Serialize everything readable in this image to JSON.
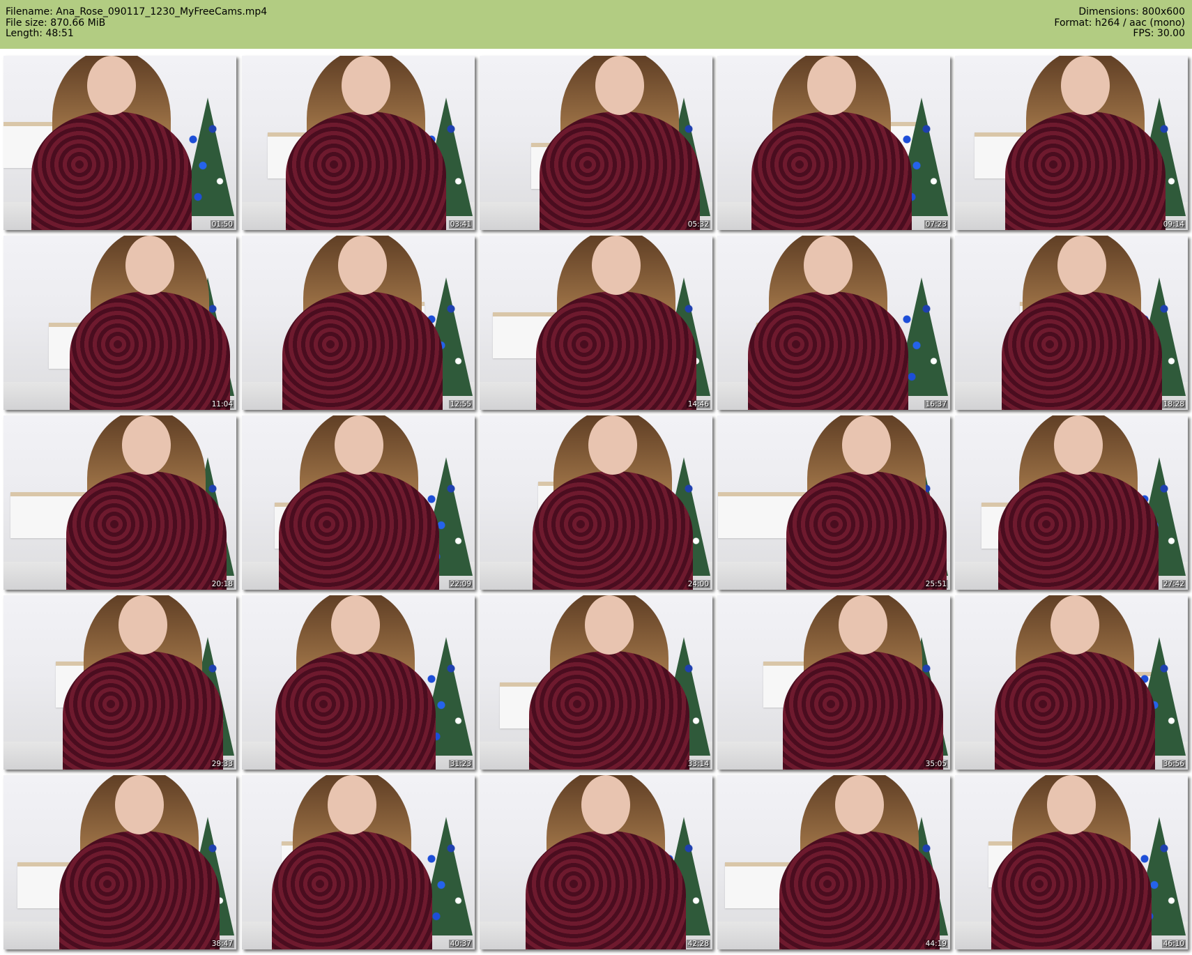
{
  "header": {
    "filename": "Filename: Ana_Rose_090117_1230_MyFreeCams.mp4",
    "file_size": "File size: 870.66 MiB",
    "length": "Length: 48:51",
    "dimensions": "Dimensions: 800x600",
    "format": "Format: h264 / aac (mono)",
    "fps": "FPS: 30.00"
  },
  "frames": [
    {
      "time": "01:50"
    },
    {
      "time": "03:41"
    },
    {
      "time": "05:32"
    },
    {
      "time": "07:23"
    },
    {
      "time": "09:14"
    },
    {
      "time": "11:04"
    },
    {
      "time": "12:55"
    },
    {
      "time": "14:46"
    },
    {
      "time": "16:37"
    },
    {
      "time": "18:28"
    },
    {
      "time": "20:18"
    },
    {
      "time": "22:09"
    },
    {
      "time": "24:00"
    },
    {
      "time": "25:51"
    },
    {
      "time": "27:42"
    },
    {
      "time": "29:33"
    },
    {
      "time": "31:23"
    },
    {
      "time": "33:14"
    },
    {
      "time": "35:05"
    },
    {
      "time": "36:56"
    },
    {
      "time": "38:47"
    },
    {
      "time": "40:37"
    },
    {
      "time": "42:28"
    },
    {
      "time": "44:19"
    },
    {
      "time": "46:10"
    }
  ],
  "colors": {
    "header_bg": "#b2cc82",
    "page_bg": "#ffffff",
    "top_color": "#6e1a2e"
  }
}
